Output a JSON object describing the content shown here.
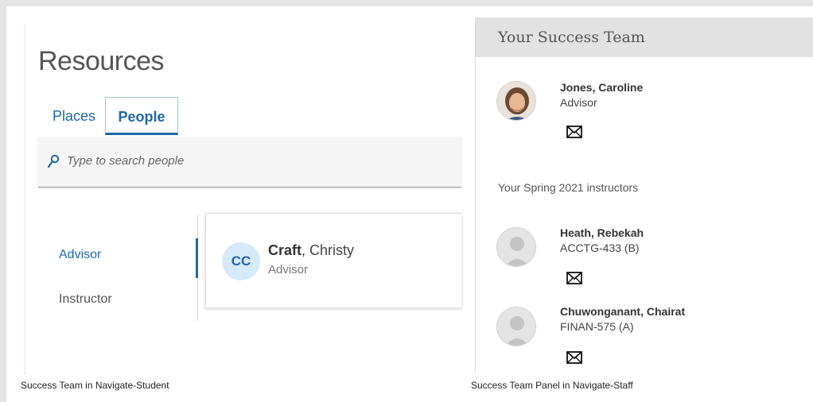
{
  "student_panel": {
    "title": "Resources",
    "tabs": [
      {
        "label": "Places",
        "active": false
      },
      {
        "label": "People",
        "active": true
      }
    ],
    "search": {
      "placeholder": "Type to search people",
      "icon": "search-icon"
    },
    "categories": [
      {
        "label": "Advisor",
        "active": true
      },
      {
        "label": "Instructor",
        "active": false
      }
    ],
    "person": {
      "initials": "CC",
      "last_name": "Craft",
      "first_name": ", Christy",
      "role": "Advisor"
    },
    "caption": "Success Team in Navigate-Student"
  },
  "staff_panel": {
    "title": "Your Success Team",
    "advisor": {
      "name": "Jones, Caroline",
      "role": "Advisor",
      "icon": "email-icon"
    },
    "instructors_label": "Your Spring 2021 instructors",
    "instructors": [
      {
        "name": "Heath, Rebekah",
        "course": "ACCTG-433 (B)",
        "icon": "email-icon"
      },
      {
        "name": "Chuwonganant, Chairat",
        "course": "FINAN-575 (A)",
        "icon": "email-icon"
      }
    ],
    "caption": "Success Team Panel in Navigate-Staff"
  },
  "colors": {
    "accent": "#1e67a8",
    "avatar_bg": "#d6e9f8",
    "header_bg": "#e2e2e2",
    "background": "#e4e4e4"
  }
}
